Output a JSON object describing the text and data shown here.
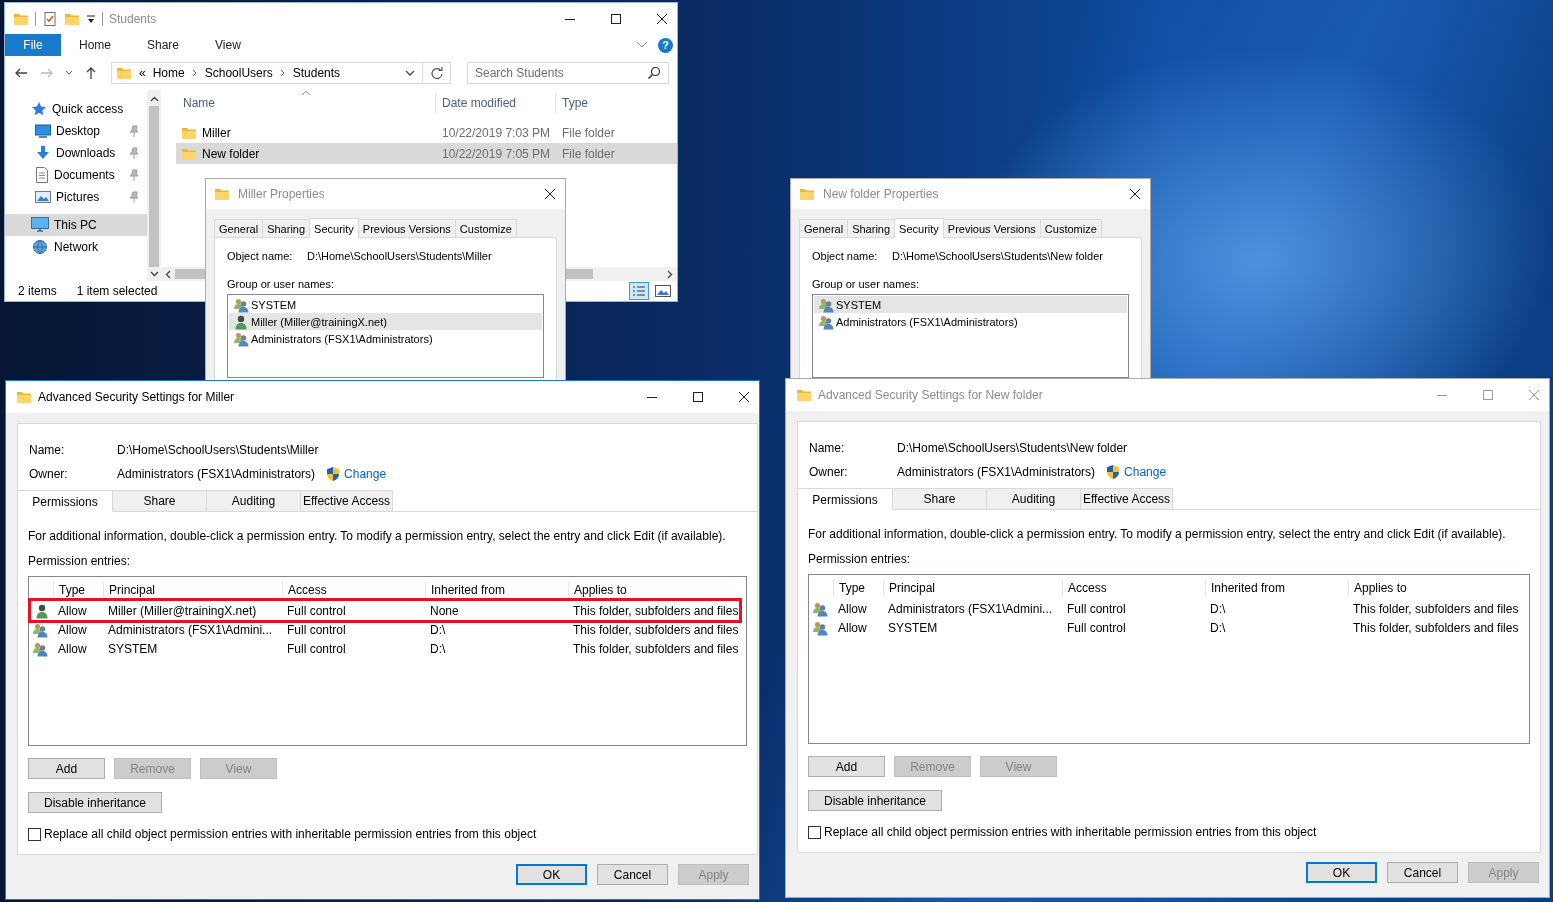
{
  "explorer": {
    "title": "Students",
    "active": false,
    "ribbon_tabs": [
      {
        "label": "File",
        "kind": "file"
      },
      {
        "label": "Home",
        "kind": "tab"
      },
      {
        "label": "Share",
        "kind": "tab"
      },
      {
        "label": "View",
        "kind": "tab"
      }
    ],
    "help": "?",
    "address": {
      "overflow": "«",
      "segments": [
        "Home",
        "SchoolUsers",
        "Students"
      ]
    },
    "search": {
      "placeholder": "Search Students"
    },
    "nav": [
      {
        "label": "Quick access",
        "kind": "star",
        "pinned": false,
        "selected": false,
        "children": [
          {
            "label": "Desktop",
            "kind": "desktop",
            "pinned": true,
            "selected": false
          },
          {
            "label": "Downloads",
            "kind": "download",
            "pinned": true,
            "selected": false
          },
          {
            "label": "Documents",
            "kind": "document",
            "pinned": true,
            "selected": false
          },
          {
            "label": "Pictures",
            "kind": "picture",
            "pinned": true,
            "selected": false
          }
        ]
      },
      {
        "label": "This PC",
        "kind": "pc",
        "pinned": false,
        "selected": true
      },
      {
        "label": "Network",
        "kind": "network",
        "pinned": false,
        "selected": false
      }
    ],
    "columns": [
      "Name",
      "Date modified",
      "Type"
    ],
    "files": [
      {
        "name": "Miller",
        "date_modified": "10/22/2019 7:03 PM",
        "type": "File folder",
        "selected": false
      },
      {
        "name": "New folder",
        "date_modified": "10/22/2019 7:05 PM",
        "type": "File folder",
        "selected": true
      }
    ],
    "status": {
      "item_count": "2 items",
      "selection": "1 item selected"
    }
  },
  "properties_dialogs": [
    {
      "title": "Miller Properties",
      "active": false,
      "tabs": [
        {
          "label": "General",
          "selected": false
        },
        {
          "label": "Sharing",
          "selected": false
        },
        {
          "label": "Security",
          "selected": true
        },
        {
          "label": "Previous Versions",
          "selected": false
        },
        {
          "label": "Customize",
          "selected": false
        }
      ],
      "object_label": "Object name:",
      "object_name": "D:\\Home\\SchoolUsers\\Students\\Miller",
      "group_label": "Group or user names:",
      "principals": [
        {
          "name": "SYSTEM",
          "kind": "group",
          "selected": false
        },
        {
          "name": "Miller (Miller@trainingX.net)",
          "kind": "user",
          "selected": true
        },
        {
          "name": "Administrators (FSX1\\Administrators)",
          "kind": "group",
          "selected": false
        }
      ]
    },
    {
      "title": "New folder Properties",
      "active": false,
      "tabs": [
        {
          "label": "General",
          "selected": false
        },
        {
          "label": "Sharing",
          "selected": false
        },
        {
          "label": "Security",
          "selected": true
        },
        {
          "label": "Previous Versions",
          "selected": false
        },
        {
          "label": "Customize",
          "selected": false
        }
      ],
      "object_label": "Object name:",
      "object_name": "D:\\Home\\SchoolUsers\\Students\\New folder",
      "group_label": "Group or user names:",
      "principals": [
        {
          "name": "SYSTEM",
          "kind": "group",
          "selected": true
        },
        {
          "name": "Administrators (FSX1\\Administrators)",
          "kind": "group",
          "selected": false
        }
      ]
    }
  ],
  "advanced_dialogs": [
    {
      "title": "Advanced Security Settings for Miller",
      "active": true,
      "name_label": "Name:",
      "name": "D:\\Home\\SchoolUsers\\Students\\Miller",
      "owner_label": "Owner:",
      "owner": "Administrators (FSX1\\Administrators)",
      "change_link": "Change",
      "tabs": [
        {
          "label": "Permissions",
          "selected": true
        },
        {
          "label": "Share",
          "selected": false
        },
        {
          "label": "Auditing",
          "selected": false
        },
        {
          "label": "Effective Access",
          "selected": false
        }
      ],
      "info": "For additional information, double-click a permission entry. To modify a permission entry, select the entry and click Edit (if available).",
      "entries_label": "Permission entries:",
      "columns": [
        "Type",
        "Principal",
        "Access",
        "Inherited from",
        "Applies to"
      ],
      "entries": [
        {
          "kind": "user",
          "type": "Allow",
          "principal": "Miller (Miller@trainingX.net)",
          "access": "Full control",
          "inherited_from": "None",
          "applies_to": "This folder, subfolders and files",
          "highlighted": true
        },
        {
          "kind": "group",
          "type": "Allow",
          "principal": "Administrators (FSX1\\Admini...",
          "access": "Full control",
          "inherited_from": "D:\\",
          "applies_to": "This folder, subfolders and files",
          "highlighted": false
        },
        {
          "kind": "group",
          "type": "Allow",
          "principal": "SYSTEM",
          "access": "Full control",
          "inherited_from": "D:\\",
          "applies_to": "This folder, subfolders and files",
          "highlighted": false
        }
      ],
      "buttons": [
        {
          "label": "Add",
          "disabled": false
        },
        {
          "label": "Remove",
          "disabled": true
        },
        {
          "label": "View",
          "disabled": true
        }
      ],
      "inheritance_button": "Disable inheritance",
      "replace_checkbox": {
        "label": "Replace all child object permission entries with inheritable permission entries from this object",
        "checked": false
      },
      "footer_buttons": [
        {
          "label": "OK",
          "default": true,
          "disabled": false
        },
        {
          "label": "Cancel",
          "default": false,
          "disabled": false
        },
        {
          "label": "Apply",
          "default": false,
          "disabled": true
        }
      ]
    },
    {
      "title": "Advanced Security Settings for New folder",
      "active": false,
      "name_label": "Name:",
      "name": "D:\\Home\\SchoolUsers\\Students\\New folder",
      "owner_label": "Owner:",
      "owner": "Administrators (FSX1\\Administrators)",
      "change_link": "Change",
      "tabs": [
        {
          "label": "Permissions",
          "selected": true
        },
        {
          "label": "Share",
          "selected": false
        },
        {
          "label": "Auditing",
          "selected": false
        },
        {
          "label": "Effective Access",
          "selected": false
        }
      ],
      "info": "For additional information, double-click a permission entry. To modify a permission entry, select the entry and click Edit (if available).",
      "entries_label": "Permission entries:",
      "columns": [
        "Type",
        "Principal",
        "Access",
        "Inherited from",
        "Applies to"
      ],
      "entries": [
        {
          "kind": "group",
          "type": "Allow",
          "principal": "Administrators (FSX1\\Admini...",
          "access": "Full control",
          "inherited_from": "D:\\",
          "applies_to": "This folder, subfolders and files",
          "highlighted": false
        },
        {
          "kind": "group",
          "type": "Allow",
          "principal": "SYSTEM",
          "access": "Full control",
          "inherited_from": "D:\\",
          "applies_to": "This folder, subfolders and files",
          "highlighted": false
        }
      ],
      "buttons": [
        {
          "label": "Add",
          "disabled": false
        },
        {
          "label": "Remove",
          "disabled": true
        },
        {
          "label": "View",
          "disabled": true
        }
      ],
      "inheritance_button": "Disable inheritance",
      "replace_checkbox": {
        "label": "Replace all child object permission entries with inheritable permission entries from this object",
        "checked": false
      },
      "footer_buttons": [
        {
          "label": "OK",
          "default": true,
          "disabled": false
        },
        {
          "label": "Cancel",
          "default": false,
          "disabled": false
        },
        {
          "label": "Apply",
          "default": false,
          "disabled": true
        }
      ]
    }
  ]
}
